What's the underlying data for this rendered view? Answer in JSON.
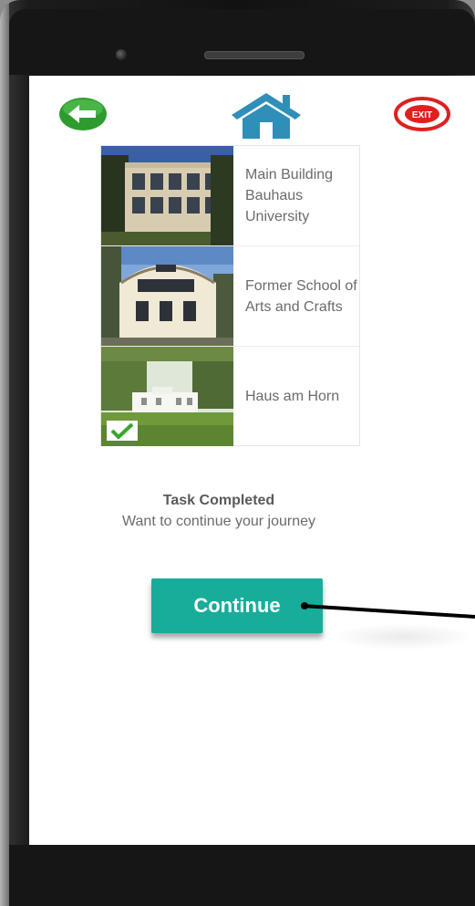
{
  "nav": {
    "back_icon": "back-arrow-icon",
    "home_icon": "home-icon",
    "exit_icon": "exit-icon",
    "exit_label": "EXIT"
  },
  "places": [
    {
      "name": "Main Building Bauhaus University",
      "completed": false
    },
    {
      "name": "Former School of Arts and Crafts",
      "completed": false
    },
    {
      "name": "Haus am Horn",
      "completed": true
    }
  ],
  "status": {
    "title": "Task Completed",
    "subtitle": "Want to continue your journey"
  },
  "continue_button": {
    "label": "Continue"
  },
  "colors": {
    "accent": "#17ad9a",
    "home": "#2f8fb8",
    "back": "#2e9b2e",
    "exit": "#e02020",
    "check": "#3aa42e"
  }
}
